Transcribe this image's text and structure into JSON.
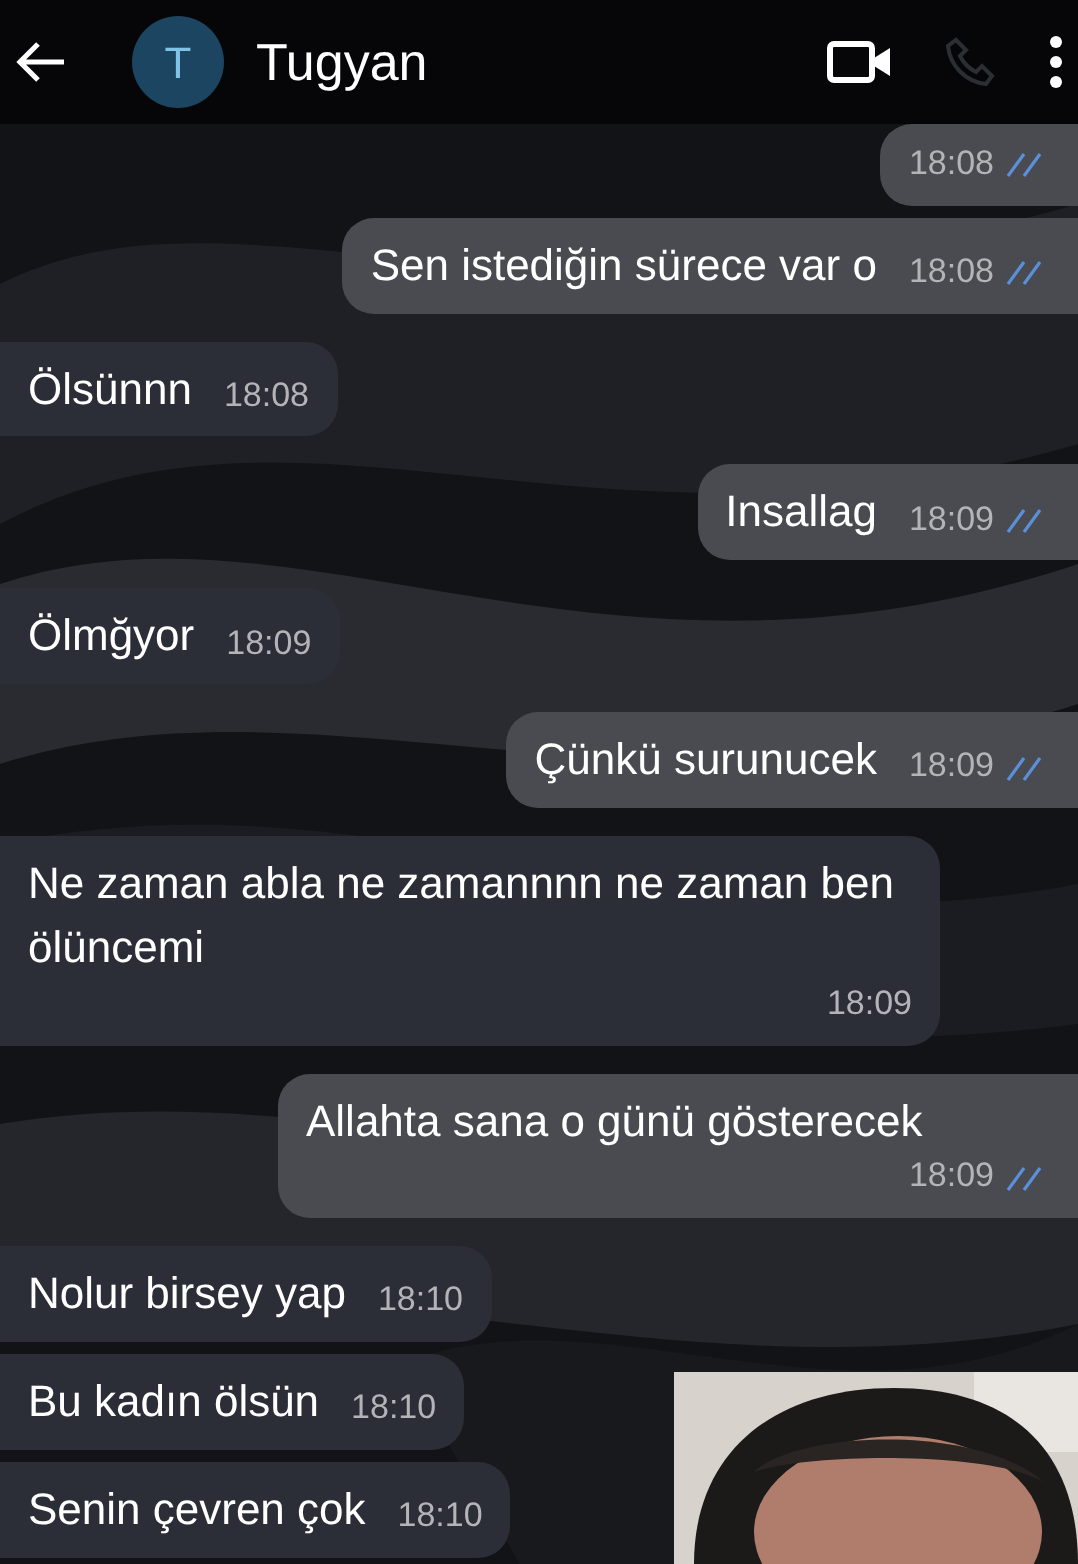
{
  "header": {
    "contact_name": "Tugyan",
    "avatar_letter": "T"
  },
  "messages": [
    {
      "kind": "outgoing",
      "time": "18:08",
      "read": true
    },
    {
      "kind": "outgoing",
      "text": "Sen istediğin sürece var o",
      "time": "18:08",
      "read": true
    },
    {
      "kind": "incoming",
      "text": "Ölsünnn",
      "time": "18:08"
    },
    {
      "kind": "outgoing",
      "text": "Insallag",
      "time": "18:09",
      "read": true
    },
    {
      "kind": "incoming",
      "text": "Ölmğyor",
      "time": "18:09"
    },
    {
      "kind": "outgoing",
      "text": "Çünkü surunucek",
      "time": "18:09",
      "read": true
    },
    {
      "kind": "incoming",
      "text": "Ne zaman abla ne zamannnn ne zaman ben ölüncemi",
      "time": "18:09"
    },
    {
      "kind": "outgoing",
      "text": "Allahta sana o günü gösterecek",
      "time": "18:09",
      "read": true
    },
    {
      "kind": "incoming",
      "text": "Nolur birsey yap",
      "time": "18:10"
    },
    {
      "kind": "incoming",
      "text": "Bu kadın ölsün",
      "time": "18:10"
    },
    {
      "kind": "incoming",
      "text": "Senin çevren çok",
      "time": "18:10"
    }
  ]
}
